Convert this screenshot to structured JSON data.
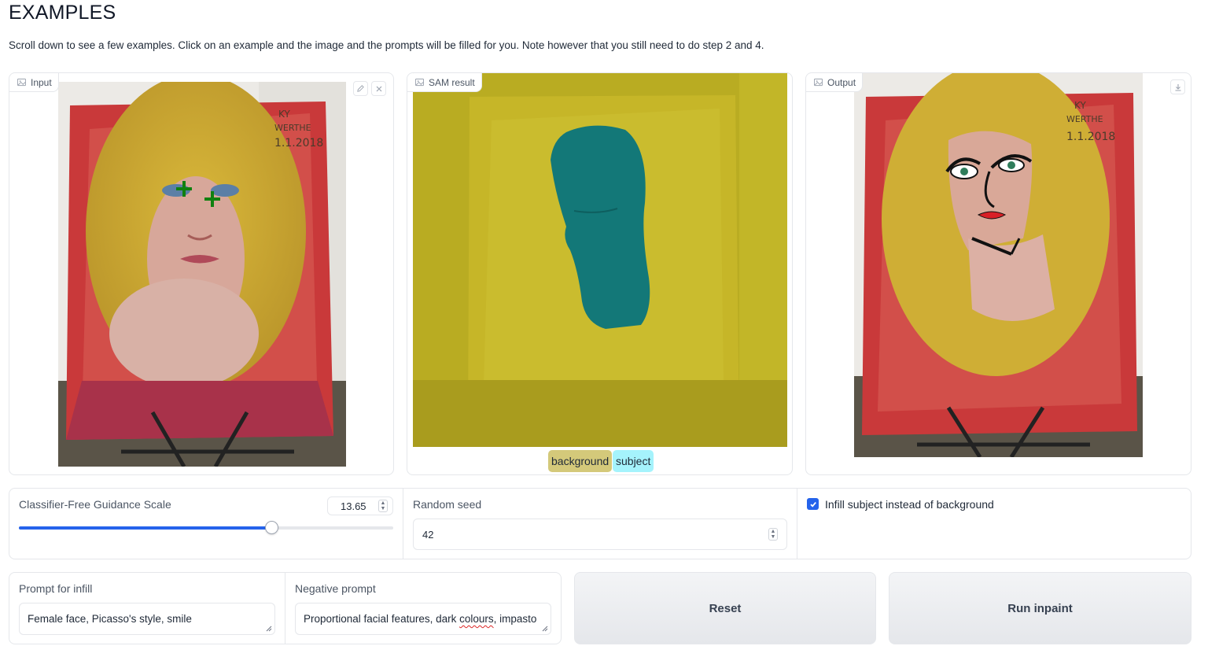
{
  "header": {
    "title": "EXAMPLES",
    "description": "Scroll down to see a few examples. Click on an example and the image and the prompts will be filled for you. Note however that you still need to do step 2 and 4."
  },
  "input_panel": {
    "label": "Input",
    "edit_icon": "pencil-icon",
    "clear_icon": "close-icon",
    "image_icon": "image-icon"
  },
  "sam_panel": {
    "label": "SAM result",
    "legend": [
      {
        "label": "background",
        "color": "#d4c97a"
      },
      {
        "label": "subject",
        "color": "#a5f3fc"
      }
    ]
  },
  "output_panel": {
    "label": "Output",
    "download_icon": "download-icon"
  },
  "controls": {
    "guidance": {
      "label": "Classifier-Free Guidance Scale",
      "value": "13.65",
      "fraction": 0.675
    },
    "seed": {
      "label": "Random seed",
      "value": "42"
    },
    "infill": {
      "label": "Infill subject instead of background",
      "checked": true
    }
  },
  "prompts": {
    "infill_label": "Prompt for infill",
    "infill_value": "Female face, Picasso's style, smile",
    "negative_label": "Negative prompt",
    "negative_value_a": "Proportional facial features, dark ",
    "negative_value_b": "colours",
    "negative_value_c": ", impasto"
  },
  "buttons": {
    "reset": "Reset",
    "run": "Run inpaint"
  },
  "colors": {
    "accent": "#2563eb",
    "sam_background_overlay": "#b9ac22",
    "sam_subject_overlay": "#137878"
  }
}
